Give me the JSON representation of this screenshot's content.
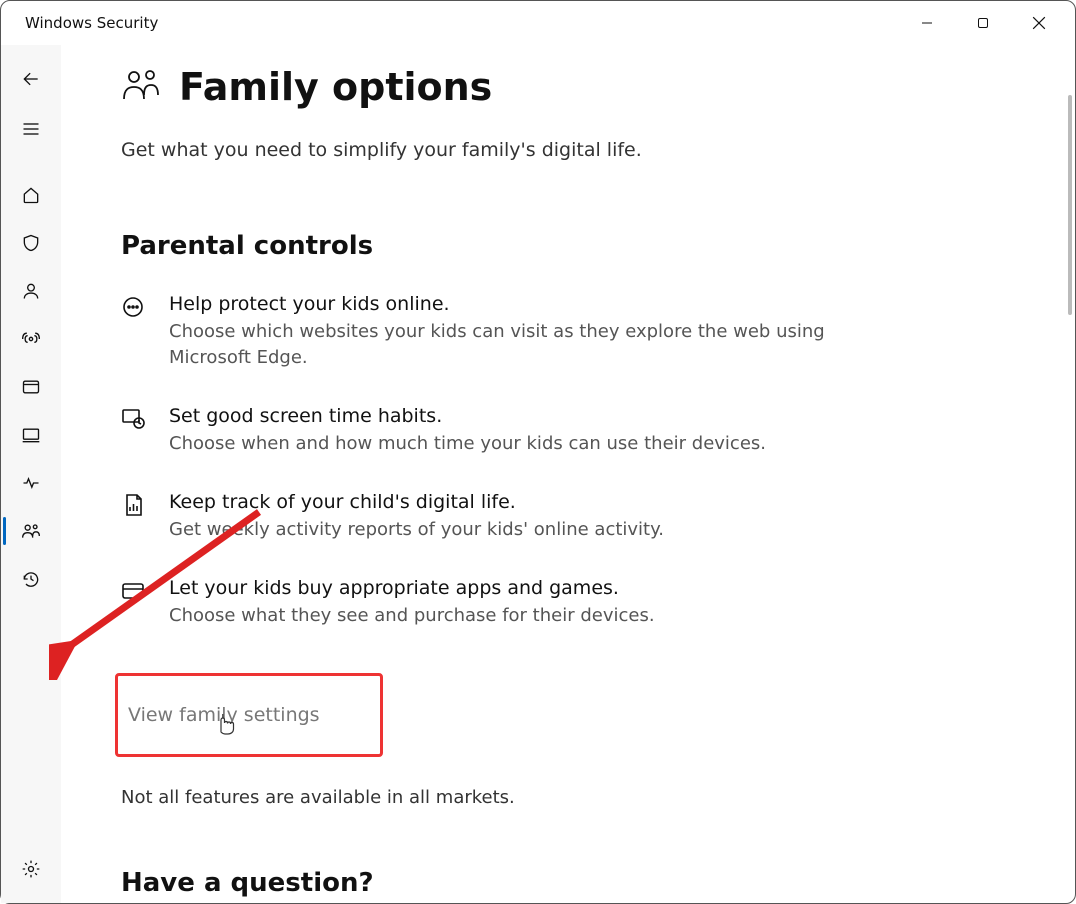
{
  "window": {
    "title": "Windows Security"
  },
  "header": {
    "title": "Family options",
    "subtitle": "Get what you need to simplify your family's digital life."
  },
  "section": {
    "title": "Parental controls"
  },
  "features": [
    {
      "title": "Help protect your kids online.",
      "desc": "Choose which websites your kids can visit as they explore the web using Microsoft Edge."
    },
    {
      "title": "Set good screen time habits.",
      "desc": "Choose when and how much time your kids can use their devices."
    },
    {
      "title": "Keep track of your child's digital life.",
      "desc": "Get weekly activity reports of your kids' online activity."
    },
    {
      "title": "Let your kids buy appropriate apps and games.",
      "desc": "Choose what they see and purchase for their devices."
    }
  ],
  "link": {
    "label": "View family settings"
  },
  "note": "Not all features are available in all markets.",
  "question": {
    "title": "Have a question?"
  },
  "sidebar": {
    "items": [
      {
        "name": "back"
      },
      {
        "name": "menu"
      },
      {
        "name": "home"
      },
      {
        "name": "virus-protection"
      },
      {
        "name": "account-protection"
      },
      {
        "name": "firewall-network"
      },
      {
        "name": "app-browser-control"
      },
      {
        "name": "device-security"
      },
      {
        "name": "device-performance"
      },
      {
        "name": "family-options"
      },
      {
        "name": "protection-history"
      },
      {
        "name": "settings"
      }
    ]
  }
}
